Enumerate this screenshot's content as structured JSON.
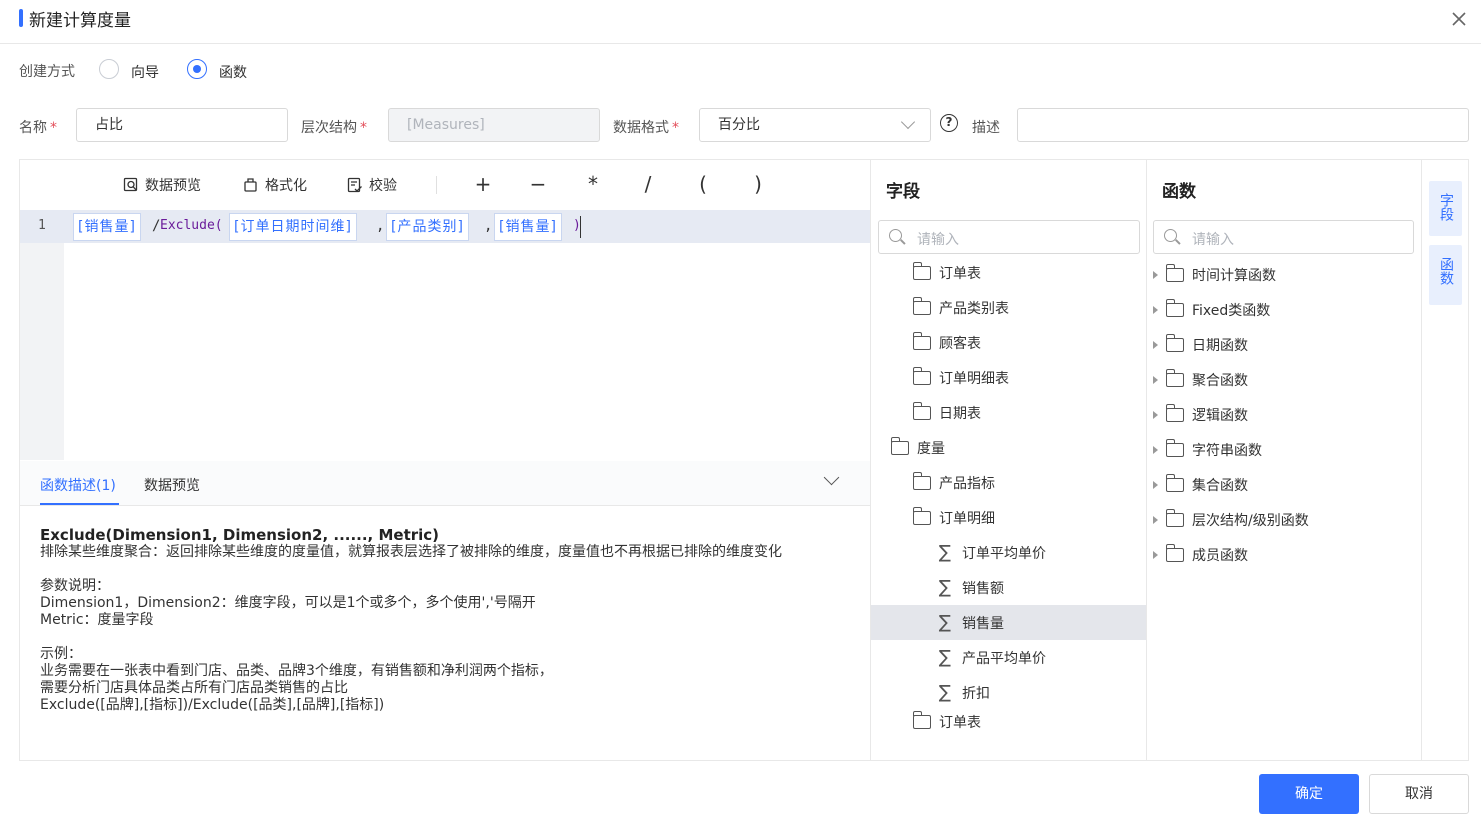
{
  "dialog": {
    "title": "新建计算度量"
  },
  "method": {
    "label": "创建方式",
    "options": [
      "向导",
      "函数"
    ],
    "selected": "函数"
  },
  "form": {
    "name_label": "名称",
    "name_value": "占比",
    "hierarchy_label": "层次结构",
    "hierarchy_value": "[Measures]",
    "format_label": "数据格式",
    "format_value": "百分比",
    "desc_label": "描述",
    "desc_value": "",
    "required_mark": "*",
    "help_symbol": "?"
  },
  "toolbar": {
    "preview": "数据预览",
    "format": "格式化",
    "validate": "校验",
    "ops": [
      "+",
      "−",
      "*",
      "/",
      "(",
      ")"
    ]
  },
  "editor": {
    "line_number": "1",
    "tokens": [
      "[销售量]",
      "[订单日期时间维]",
      "[产品类别]",
      "[销售量]"
    ],
    "fn_open": "Exclude(",
    "divider": "/",
    "comma": ",",
    "close": ")"
  },
  "bottom_tabs": {
    "desc_tab": "函数描述(1)",
    "preview_tab": "数据预览"
  },
  "description": {
    "signature": "Exclude(Dimension1, Dimension2, ......, Metric)",
    "summary": "排除某些维度聚合：返回排除某些维度的度量值，就算报表层选择了被排除的维度，度量值也不再根据已排除的维度变化",
    "params_title": "参数说明：",
    "param1": "Dimension1，Dimension2：维度字段，可以是1个或多个，多个使用','号隔开",
    "param2": "Metric：度量字段",
    "example_title": "示例：",
    "example1": "业务需要在一张表中看到门店、品类、品牌3个维度，有销售额和净利润两个指标，",
    "example2": "需要分析门店具体品类占所有门店品类销售的占比",
    "example3": "Exclude([品牌],[指标])/Exclude([品类],[品牌],[指标])"
  },
  "fields_panel": {
    "title": "字段",
    "search_placeholder": "请输入",
    "items": [
      {
        "label": "订单表"
      },
      {
        "label": "产品类别表"
      },
      {
        "label": "顾客表"
      },
      {
        "label": "订单明细表"
      },
      {
        "label": "日期表"
      },
      {
        "label": "度量"
      },
      {
        "label": "产品指标"
      },
      {
        "label": "订单明细"
      },
      {
        "label": "订单平均单价"
      },
      {
        "label": "销售额"
      },
      {
        "label": "销售量"
      },
      {
        "label": "产品平均单价"
      },
      {
        "label": "折扣"
      },
      {
        "label": "订单表"
      }
    ]
  },
  "functions_panel": {
    "title": "函数",
    "search_placeholder": "请输入",
    "items": [
      "时间计算函数",
      "Fixed类函数",
      "日期函数",
      "聚合函数",
      "逻辑函数",
      "字符串函数",
      "集合函数",
      "层次结构/级别函数",
      "成员函数"
    ]
  },
  "side_tabs": {
    "fields": "字段",
    "functions": "函数"
  },
  "footer": {
    "confirm": "确定",
    "cancel": "取消"
  },
  "colors": {
    "accent": "#3370ff",
    "selected_row": "#e4e6eb"
  },
  "icons": [
    "close-icon",
    "search-icon",
    "folder-icon",
    "folder-open-icon",
    "sigma-icon",
    "chevron-down-icon",
    "help-icon"
  ]
}
